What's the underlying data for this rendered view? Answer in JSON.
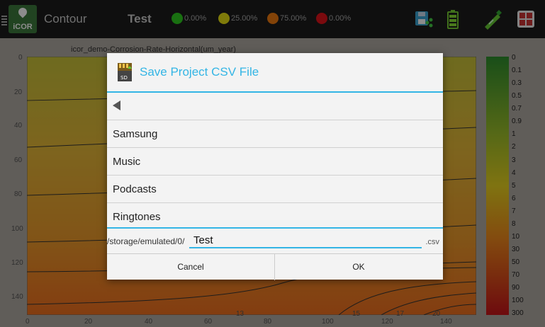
{
  "topbar": {
    "app_name": "Contour",
    "logo_text": "iCOR",
    "project_name": "Test",
    "legend": [
      {
        "label": "0.00%",
        "color": "#2ecc1f"
      },
      {
        "label": "25.00%",
        "color": "#e8e013"
      },
      {
        "label": "75.00%",
        "color": "#ef7a10"
      },
      {
        "label": "0.00%",
        "color": "#e0131a"
      }
    ],
    "icons": [
      "save-export-icon",
      "battery-icon",
      "probe-icon",
      "grid-icon"
    ]
  },
  "plot": {
    "title": "icor_demo-Corrosion-Rate-Horizontal(um_year)",
    "y_ticks": [
      "0",
      "20",
      "40",
      "60",
      "80",
      "100",
      "120",
      "140"
    ],
    "x_ticks": [
      "0",
      "20",
      "40",
      "60",
      "80",
      "100",
      "120",
      "140"
    ],
    "contour_labels": [
      "13",
      "15",
      "17",
      "20"
    ]
  },
  "colorbar": {
    "labels": [
      "0",
      "0.1",
      "0.3",
      "0.5",
      "0.7",
      "0.9",
      "1",
      "2",
      "3",
      "4",
      "5",
      "6",
      "7",
      "8",
      "10",
      "30",
      "50",
      "70",
      "90",
      "100",
      "300"
    ]
  },
  "dialog": {
    "title": "Save Project CSV File",
    "folders": [
      "Samsung",
      "Music",
      "Podcasts",
      "Ringtones"
    ],
    "path_prefix": "/storage/emulated/0/",
    "filename": "Test",
    "extension": ".csv",
    "cancel_label": "Cancel",
    "ok_label": "OK"
  }
}
